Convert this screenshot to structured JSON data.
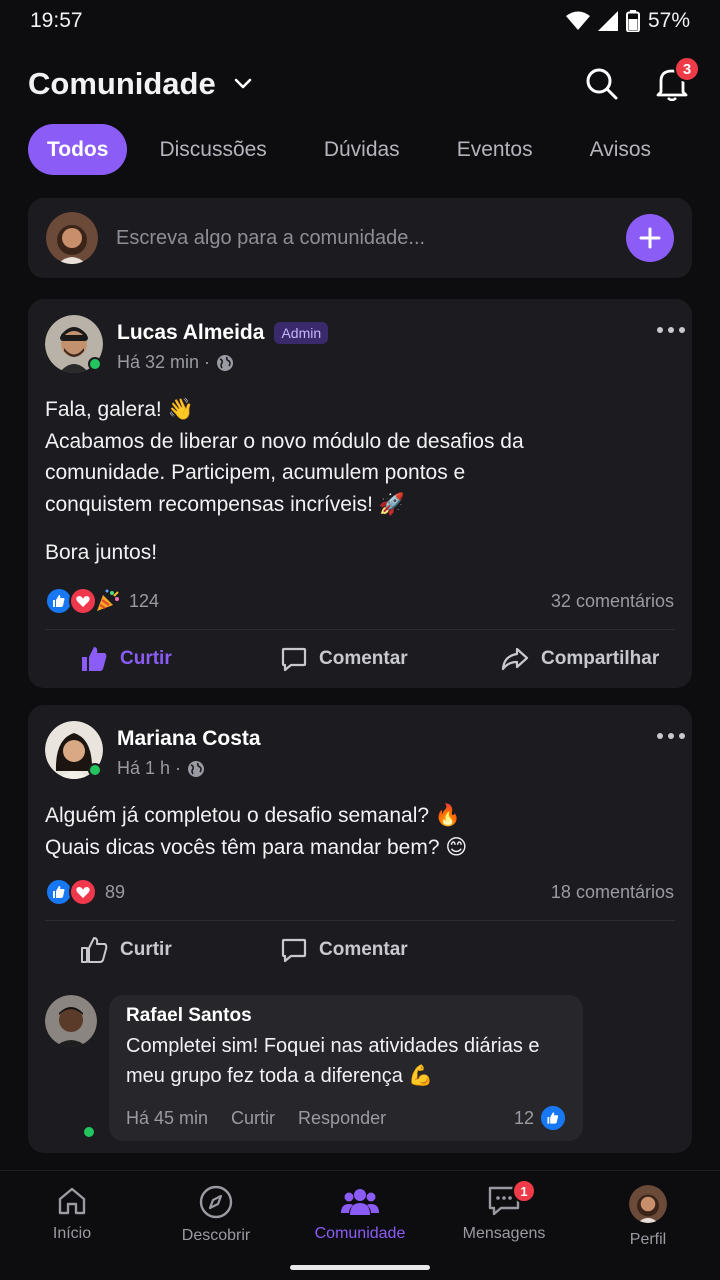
{
  "status_bar": {
    "time": "19:57",
    "battery": "57%"
  },
  "header": {
    "title": "Comunidade",
    "notification_count": "3"
  },
  "tabs": [
    {
      "label": "Todos",
      "active": true
    },
    {
      "label": "Discussões"
    },
    {
      "label": "Dúvidas"
    },
    {
      "label": "Eventos"
    },
    {
      "label": "Avisos"
    }
  ],
  "composer": {
    "placeholder": "Escreva algo para a comunidade..."
  },
  "posts": [
    {
      "author": "Lucas Almeida",
      "badge": "Admin",
      "time": "Há 32 min ·",
      "body": [
        "Fala, galera! 👋",
        "Acabamos de liberar o novo módulo de desafios da",
        "comunidade. Participem, acumulem pontos e",
        "conquistem recompensas incríveis! 🚀",
        "Bora juntos!"
      ],
      "reaction_count": "124",
      "comments": "32 comentários",
      "actions": {
        "like": "Curtir",
        "comment": "Comentar",
        "share": "Compartilhar"
      }
    },
    {
      "author": "Mariana Costa",
      "time": "Há 1 h ·",
      "body": [
        "Alguém já completou o desafio semanal? 🔥",
        "Quais dicas vocês têm para mandar bem? 😊"
      ],
      "reaction_count": "89",
      "comments": "18 comentários",
      "actions": {
        "like": "Curtir",
        "comment": "Comentar"
      },
      "reply": {
        "author": "Rafael Santos",
        "text": [
          "Completei sim! Foquei nas atividades diárias e",
          "meu grupo fez toda a diferença 💪"
        ],
        "time": "Há 45 min",
        "like": "Curtir",
        "respond": "Responder",
        "likes": "12"
      }
    }
  ],
  "bottom_nav": [
    {
      "label": "Início",
      "icon": "home-icon"
    },
    {
      "label": "Descobrir",
      "icon": "compass-icon"
    },
    {
      "label": "Comunidade",
      "icon": "community-icon",
      "active": true
    },
    {
      "label": "Mensagens",
      "icon": "messages-icon",
      "badge": "1"
    },
    {
      "label": "Perfil",
      "icon": "profile-avatar"
    }
  ],
  "colors": {
    "accent": "#8b5cf6",
    "background": "#0d0d0f",
    "card": "#1c1c20",
    "badge_red": "#ef3b47",
    "online": "#22c55e",
    "like_blue": "#1877f2",
    "love_red": "#f0384c"
  }
}
